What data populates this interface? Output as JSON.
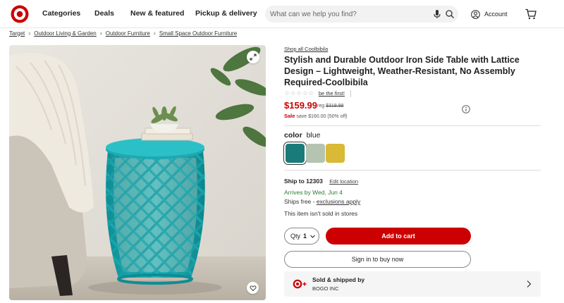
{
  "header": {
    "nav": [
      "Categories",
      "Deals",
      "New & featured",
      "Pickup & delivery"
    ],
    "search_placeholder": "What can we help you find?",
    "account_label": "Account",
    "brand_color": "#cc0000"
  },
  "breadcrumb": [
    "Target",
    "Outdoor Living & Garden",
    "Outdoor Furniture",
    "Small Space Outdoor Furniture"
  ],
  "product": {
    "shop_all": "Shop all Coolbibila",
    "title": "Stylish and Durable Outdoor Iron Side Table with Lattice Design – Lightweight, Weather-Resistant, No Assembly Required-Coolbibila",
    "rating_stars": "☆☆☆☆☆",
    "rating_link": "be the first!",
    "price": "$159.99",
    "reg_label": "reg",
    "reg_price": "$319.99",
    "sale_label": "Sale",
    "sale_detail": "save $160.00 (50% off)",
    "color_label": "color",
    "color_value": "blue",
    "swatches": [
      {
        "name": "blue",
        "color": "#1a7c7a"
      },
      {
        "name": "sage",
        "color": "#b5c4b1"
      },
      {
        "name": "yellow",
        "color": "#d9b935"
      }
    ]
  },
  "fulfillment": {
    "ship_to_label": "Ship to 12303",
    "edit_location": "Edit location",
    "arrives": "Arrives by Wed, Jun 4",
    "ships_free_prefix": "Ships free - ",
    "exclusions": "exclusions apply",
    "not_sold": "This item isn't sold in stores"
  },
  "actions": {
    "qty_label": "Qty",
    "qty_value": "1",
    "add_to_cart": "Add to cart",
    "sign_in": "Sign in to buy now"
  },
  "seller": {
    "title": "Sold & shipped by",
    "name": "BOGO INC"
  }
}
